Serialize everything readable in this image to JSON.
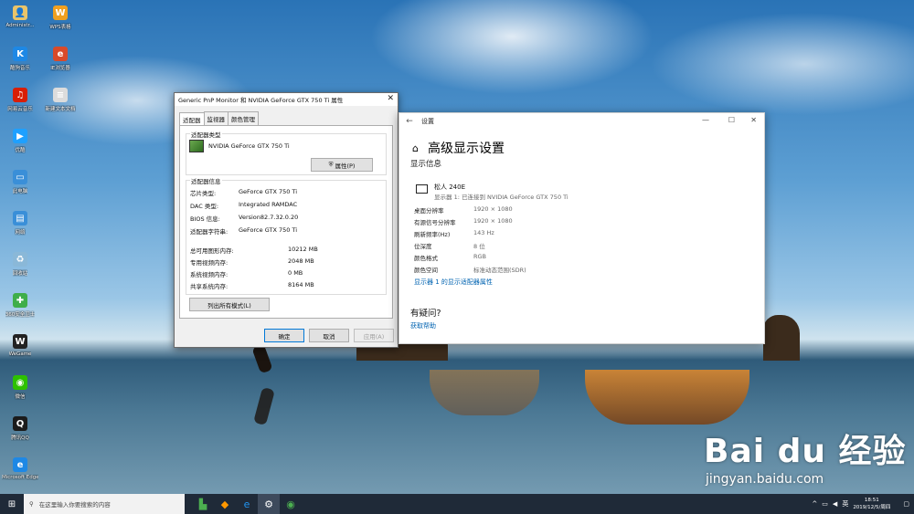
{
  "desktop": {
    "icons_col1": [
      {
        "label": "Administr...",
        "icon": "user-folder-icon",
        "color": "#e9c46a",
        "glyph": "👤"
      },
      {
        "label": "酷狗音乐",
        "icon": "kugou-icon",
        "color": "#1e88e5",
        "glyph": "K"
      },
      {
        "label": "网易云音乐",
        "icon": "netease-music-icon",
        "color": "#d81e06",
        "glyph": "♫"
      },
      {
        "label": "优酷",
        "icon": "youku-icon",
        "color": "#1ea0ff",
        "glyph": "▶"
      },
      {
        "label": "此电脑",
        "icon": "this-pc-icon",
        "color": "#3a8fd8",
        "glyph": "▭"
      },
      {
        "label": "网络",
        "icon": "network-icon",
        "color": "#3a8fd8",
        "glyph": "▤"
      },
      {
        "label": "回收站",
        "icon": "recycle-bin-icon",
        "color": "#8ab8d8",
        "glyph": "♻"
      },
      {
        "label": "360安全卫士",
        "icon": "security-360-icon",
        "color": "#3fae49",
        "glyph": "✚"
      },
      {
        "label": "WeGame",
        "icon": "wegame-icon",
        "color": "#222222",
        "glyph": "W"
      },
      {
        "label": "微信",
        "icon": "wechat-icon",
        "color": "#2dc100",
        "glyph": "◉"
      },
      {
        "label": "腾讯QQ",
        "icon": "qq-icon",
        "color": "#1b1b1b",
        "glyph": "Q"
      },
      {
        "label": "Microsoft Edge",
        "icon": "edge-icon",
        "color": "#1e88e5",
        "glyph": "e"
      }
    ],
    "icons_col2": [
      {
        "label": "WPS表格",
        "icon": "wps-icon",
        "color": "#f0a020",
        "glyph": "W"
      },
      {
        "label": "IE浏览器",
        "icon": "ie-icon",
        "color": "#d84a2a",
        "glyph": "e"
      },
      {
        "label": "新建文本文档",
        "icon": "text-doc-icon",
        "color": "#dcdcdc",
        "glyph": "≡"
      }
    ]
  },
  "props_dialog": {
    "title": "Generic PnP Monitor 和 NVIDIA GeForce GTX 750 Ti 属性",
    "tabs": [
      "适配器",
      "监视器",
      "颜色管理"
    ],
    "adapter_type_label": "适配器类型",
    "adapter_name": "NVIDIA GeForce GTX 750 Ti",
    "properties_button": "属性(P)",
    "adapter_info_label": "适配器信息",
    "info": [
      {
        "k": "芯片类型:",
        "v": "GeForce GTX 750 Ti"
      },
      {
        "k": "DAC 类型:",
        "v": "Integrated RAMDAC"
      },
      {
        "k": "BIOS 信息:",
        "v": "Version82.7.32.0.20"
      },
      {
        "k": "适配器字符串:",
        "v": "GeForce GTX 750 Ti"
      }
    ],
    "memory": [
      {
        "k": "总可用图形内存:",
        "v": "10212 MB"
      },
      {
        "k": "专用视频内存:",
        "v": "2048 MB"
      },
      {
        "k": "系统视频内存:",
        "v": "0 MB"
      },
      {
        "k": "共享系统内存:",
        "v": "8164 MB"
      }
    ],
    "list_modes_button": "列出所有模式(L)",
    "ok": "确定",
    "cancel": "取消",
    "apply": "应用(A)"
  },
  "settings": {
    "app_title": "设置",
    "heading": "高级显示设置",
    "section": "显示信息",
    "monitor_name": "松人 240E",
    "monitor_desc": "显示器 1: 已连接到 NVIDIA GeForce GTX 750 Ti",
    "rows": [
      {
        "k": "桌面分辨率",
        "v": "1920 × 1080"
      },
      {
        "k": "有源信号分辨率",
        "v": "1920 × 1080"
      },
      {
        "k": "刷新频率(Hz)",
        "v": "143 Hz"
      },
      {
        "k": "位深度",
        "v": "8 位"
      },
      {
        "k": "颜色格式",
        "v": "RGB"
      },
      {
        "k": "颜色空间",
        "v": "标准动态范围(SDR)"
      }
    ],
    "adapter_link": "显示器 1 的显示适配器属性",
    "question": "有疑问?",
    "help_link": "获取帮助"
  },
  "taskbar": {
    "search_placeholder": "在这里输入你要搜索的内容",
    "time": "18:51",
    "date": "2019/12/5/周四"
  },
  "watermark": {
    "brand": "Bai du 经验",
    "url": "jingyan.baidu.com"
  }
}
